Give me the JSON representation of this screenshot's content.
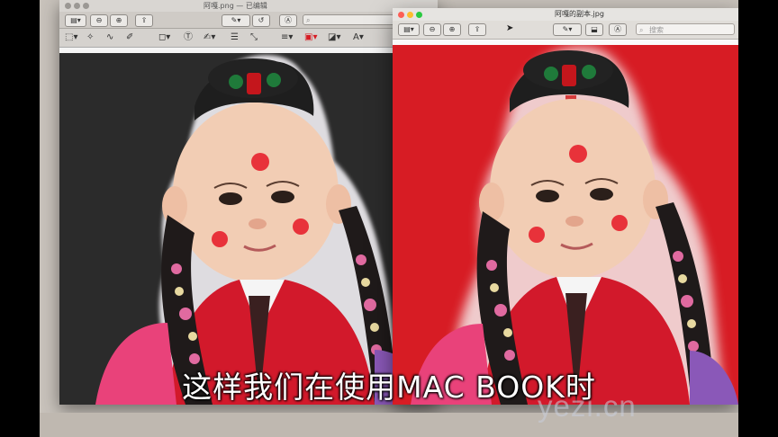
{
  "back_window": {
    "title": "阿嘎.png — 已编辑"
  },
  "front_window": {
    "title": "阿嘎的副本.jpg",
    "search_placeholder": "搜索"
  },
  "subtitle": "这样我们在使用MAC BOOK时",
  "watermark": "yezi.cn",
  "colors": {
    "back_canvas": "#2b2b2b",
    "front_canvas": "#d71c24",
    "red_dot": "#e8323a"
  },
  "icons": [
    "sidebar-icon",
    "zoom-out-icon",
    "zoom-in-icon",
    "share-icon",
    "pen-icon",
    "rotate-icon",
    "markup-icon",
    "search-icon",
    "selection-icon",
    "instant-alpha-icon",
    "sketch-icon",
    "draw-icon",
    "shapes-icon",
    "text-icon",
    "sign-icon",
    "adjust-color-icon",
    "adjust-size-icon",
    "shape-style-icon",
    "border-color-icon",
    "fill-color-icon",
    "text-style-icon"
  ]
}
